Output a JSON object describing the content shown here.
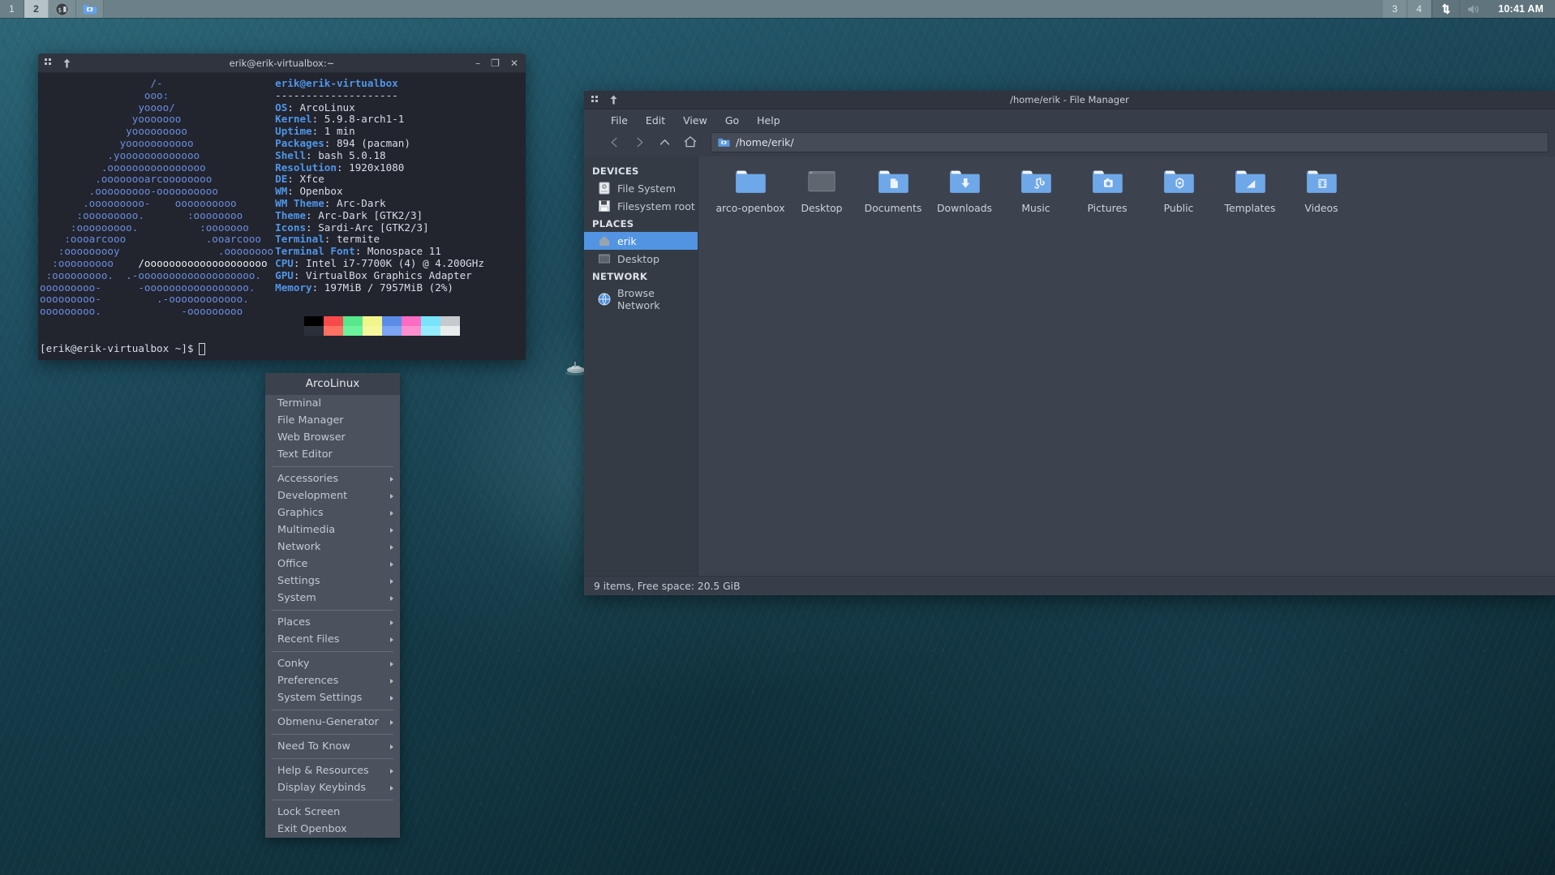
{
  "panel": {
    "workspaces": [
      {
        "label": "1",
        "active": false
      },
      {
        "label": "2",
        "active": true
      }
    ],
    "tasks": [
      {
        "name": "terminal-task",
        "icon": "terminal-icon"
      },
      {
        "name": "filemanager-task",
        "icon": "folder-icon"
      }
    ],
    "right_workspaces": [
      {
        "label": "3",
        "active": false
      },
      {
        "label": "4",
        "active": false
      }
    ],
    "tray": [
      {
        "name": "network-tray-icon",
        "icon": "up-down-arrows-icon"
      },
      {
        "name": "volume-tray-icon",
        "icon": "speaker-icon"
      }
    ],
    "clock": "10:41 AM"
  },
  "terminal": {
    "title": "erik@erik-virtualbox:~",
    "buttons": {
      "minimize": "–",
      "maximize": "❐",
      "close": "✕"
    },
    "logo_lines": [
      "                  /-",
      "                 ooo:",
      "                yoooo/",
      "               yooooooo",
      "              yooooooooo",
      "             yooooooooooo",
      "           .yooooooooooooo",
      "          .oooooooooooooooo",
      "         .oooooooarcoooooooo",
      "        .ooooooooo-oooooooooo",
      "       .ooooooooo-    oooooooooo",
      "      :ooooooooo.       :oooooooo",
      "     :ooooooooo.          :ooooooo",
      "    :oooarcooo             .ooarcooo",
      "   :ooooooooy                .oooooooo",
      "  :ooooooooo    /oooooooooooooooooooo",
      " :ooooooooo.  .-ooooooooooooooooooo.",
      "ooooooooo-      -ooooooooooooooooo.",
      "ooooooooo-         .-oooooooooooo.",
      "ooooooooo.             -ooooooooo"
    ],
    "info": {
      "user_host": "erik@erik-virtualbox",
      "rule": "--------------------",
      "rows": [
        {
          "key": "OS",
          "value": "ArcoLinux"
        },
        {
          "key": "Kernel",
          "value": "5.9.8-arch1-1"
        },
        {
          "key": "Uptime",
          "value": "1 min"
        },
        {
          "key": "Packages",
          "value": "894 (pacman)"
        },
        {
          "key": "Shell",
          "value": "bash 5.0.18"
        },
        {
          "key": "Resolution",
          "value": "1920x1080"
        },
        {
          "key": "DE",
          "value": "Xfce"
        },
        {
          "key": "WM",
          "value": "Openbox"
        },
        {
          "key": "WM Theme",
          "value": "Arc-Dark"
        },
        {
          "key": "Theme",
          "value": "Arc-Dark [GTK2/3]"
        },
        {
          "key": "Icons",
          "value": "Sardi-Arc [GTK2/3]"
        },
        {
          "key": "Terminal",
          "value": "termite"
        },
        {
          "key": "Terminal Font",
          "value": "Monospace 11"
        },
        {
          "key": "CPU",
          "value": "Intel i7-7700K (4) @ 4.200GHz"
        },
        {
          "key": "GPU",
          "value": "VirtualBox Graphics Adapter"
        },
        {
          "key": "Memory",
          "value": "197MiB / 7957MiB (2%)"
        }
      ]
    },
    "palette_row1": [
      "#000000",
      "#f74a4a",
      "#57e88b",
      "#f2f58c",
      "#5b8de8",
      "#fb6cc2",
      "#78e4f9",
      "#c6c9cd"
    ],
    "palette_row2": [
      "#2b303b",
      "#fb7262",
      "#6cf29a",
      "#f4f79c",
      "#7ba4f2",
      "#fc8fd0",
      "#95ecfc",
      "#e9eced"
    ],
    "prompt": "[erik@erik-virtualbox ~]$"
  },
  "openbox_menu": {
    "header": "ArcoLinux",
    "items": [
      {
        "label": "Terminal",
        "submenu": false,
        "sep_after": false
      },
      {
        "label": "File Manager",
        "submenu": false,
        "sep_after": false
      },
      {
        "label": "Web Browser",
        "submenu": false,
        "sep_after": false
      },
      {
        "label": "Text Editor",
        "submenu": false,
        "sep_after": true
      },
      {
        "label": "Accessories",
        "submenu": true,
        "sep_after": false
      },
      {
        "label": "Development",
        "submenu": true,
        "sep_after": false
      },
      {
        "label": "Graphics",
        "submenu": true,
        "sep_after": false
      },
      {
        "label": "Multimedia",
        "submenu": true,
        "sep_after": false
      },
      {
        "label": "Network",
        "submenu": true,
        "sep_after": false
      },
      {
        "label": "Office",
        "submenu": true,
        "sep_after": false
      },
      {
        "label": "Settings",
        "submenu": true,
        "sep_after": false
      },
      {
        "label": "System",
        "submenu": true,
        "sep_after": true
      },
      {
        "label": "Places",
        "submenu": true,
        "sep_after": false
      },
      {
        "label": "Recent Files",
        "submenu": true,
        "sep_after": true
      },
      {
        "label": "Conky",
        "submenu": true,
        "sep_after": false
      },
      {
        "label": "Preferences",
        "submenu": true,
        "sep_after": false
      },
      {
        "label": "System Settings",
        "submenu": true,
        "sep_after": true
      },
      {
        "label": "Obmenu-Generator",
        "submenu": true,
        "sep_after": true
      },
      {
        "label": "Need To Know",
        "submenu": true,
        "sep_after": true
      },
      {
        "label": "Help & Resources",
        "submenu": true,
        "sep_after": false
      },
      {
        "label": "Display Keybinds",
        "submenu": true,
        "sep_after": true
      },
      {
        "label": "Lock Screen",
        "submenu": false,
        "sep_after": false
      },
      {
        "label": "Exit Openbox",
        "submenu": false,
        "sep_after": false
      }
    ]
  },
  "file_manager": {
    "title": "/home/erik - File Manager",
    "menus": [
      "File",
      "Edit",
      "View",
      "Go",
      "Help"
    ],
    "path": "/home/erik/",
    "nav": {
      "back": "back-icon",
      "forward": "forward-icon",
      "up": "up-icon",
      "home": "home-icon"
    },
    "sidebar": [
      {
        "type": "header",
        "label": "DEVICES"
      },
      {
        "type": "item",
        "label": "File System",
        "icon": "drive-icon",
        "selected": false
      },
      {
        "type": "item",
        "label": "Filesystem root",
        "icon": "floppy-icon",
        "selected": false
      },
      {
        "type": "header",
        "label": "PLACES"
      },
      {
        "type": "item",
        "label": "erik",
        "icon": "home-folder-icon",
        "selected": true
      },
      {
        "type": "item",
        "label": "Desktop",
        "icon": "desktop-icon",
        "selected": false
      },
      {
        "type": "header",
        "label": "NETWORK"
      },
      {
        "type": "item",
        "label": "Browse Network",
        "icon": "network-globe-icon",
        "selected": false
      }
    ],
    "files": [
      {
        "label": "arco-openbox",
        "icon": "folder-plain"
      },
      {
        "label": "Desktop",
        "icon": "folder-desktop"
      },
      {
        "label": "Documents",
        "icon": "folder-documents"
      },
      {
        "label": "Downloads",
        "icon": "folder-downloads"
      },
      {
        "label": "Music",
        "icon": "folder-music"
      },
      {
        "label": "Pictures",
        "icon": "folder-pictures"
      },
      {
        "label": "Public",
        "icon": "folder-public"
      },
      {
        "label": "Templates",
        "icon": "folder-templates"
      },
      {
        "label": "Videos",
        "icon": "folder-videos"
      }
    ],
    "status": "9 items, Free space: 20.5 GiB"
  },
  "colors": {
    "accent": "#5294e2",
    "window_dark": "#2f343f",
    "panel": "#6b8089",
    "terminal_bg": "#22242e",
    "menu_bg": "#4b525e"
  }
}
